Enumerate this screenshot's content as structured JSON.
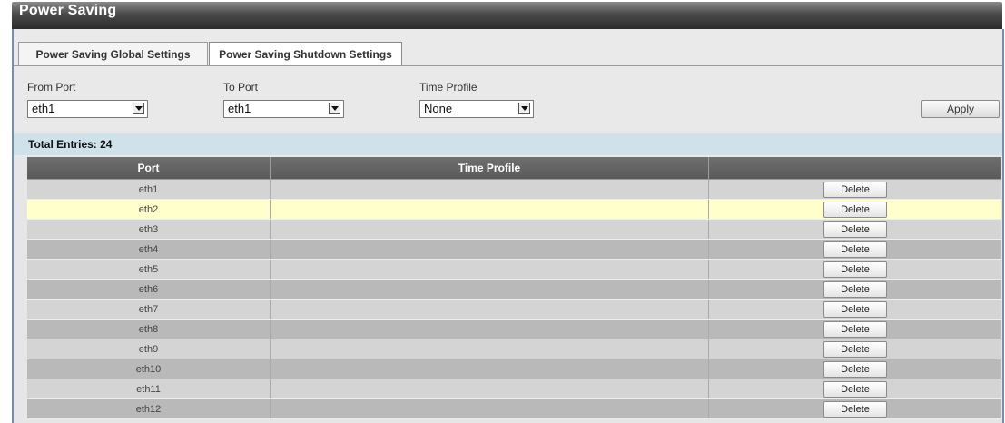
{
  "window": {
    "title": "Power Saving"
  },
  "tabs": [
    {
      "label": "Power Saving Global Settings",
      "active": false
    },
    {
      "label": "Power Saving Shutdown Settings",
      "active": true
    }
  ],
  "form": {
    "from_port": {
      "label": "From Port",
      "value": "eth1"
    },
    "to_port": {
      "label": "To Port",
      "value": "eth1"
    },
    "time_profile": {
      "label": "Time Profile",
      "value": "None"
    },
    "apply_label": "Apply"
  },
  "total_entries_text": "Total Entries: 24",
  "table": {
    "headers": [
      "Port",
      "Time Profile",
      ""
    ],
    "delete_label": "Delete",
    "rows": [
      {
        "port": "eth1",
        "time_profile": ""
      },
      {
        "port": "eth2",
        "time_profile": ""
      },
      {
        "port": "eth3",
        "time_profile": ""
      },
      {
        "port": "eth4",
        "time_profile": ""
      },
      {
        "port": "eth5",
        "time_profile": ""
      },
      {
        "port": "eth6",
        "time_profile": ""
      },
      {
        "port": "eth7",
        "time_profile": ""
      },
      {
        "port": "eth8",
        "time_profile": ""
      },
      {
        "port": "eth9",
        "time_profile": ""
      },
      {
        "port": "eth10",
        "time_profile": ""
      },
      {
        "port": "eth11",
        "time_profile": ""
      },
      {
        "port": "eth12",
        "time_profile": ""
      }
    ]
  },
  "colors": {
    "title_bar": "#3a3a3a",
    "header_bg": "#626262",
    "highlight_row": "#ffffcc",
    "entries_bar": "#cfe2ea"
  }
}
